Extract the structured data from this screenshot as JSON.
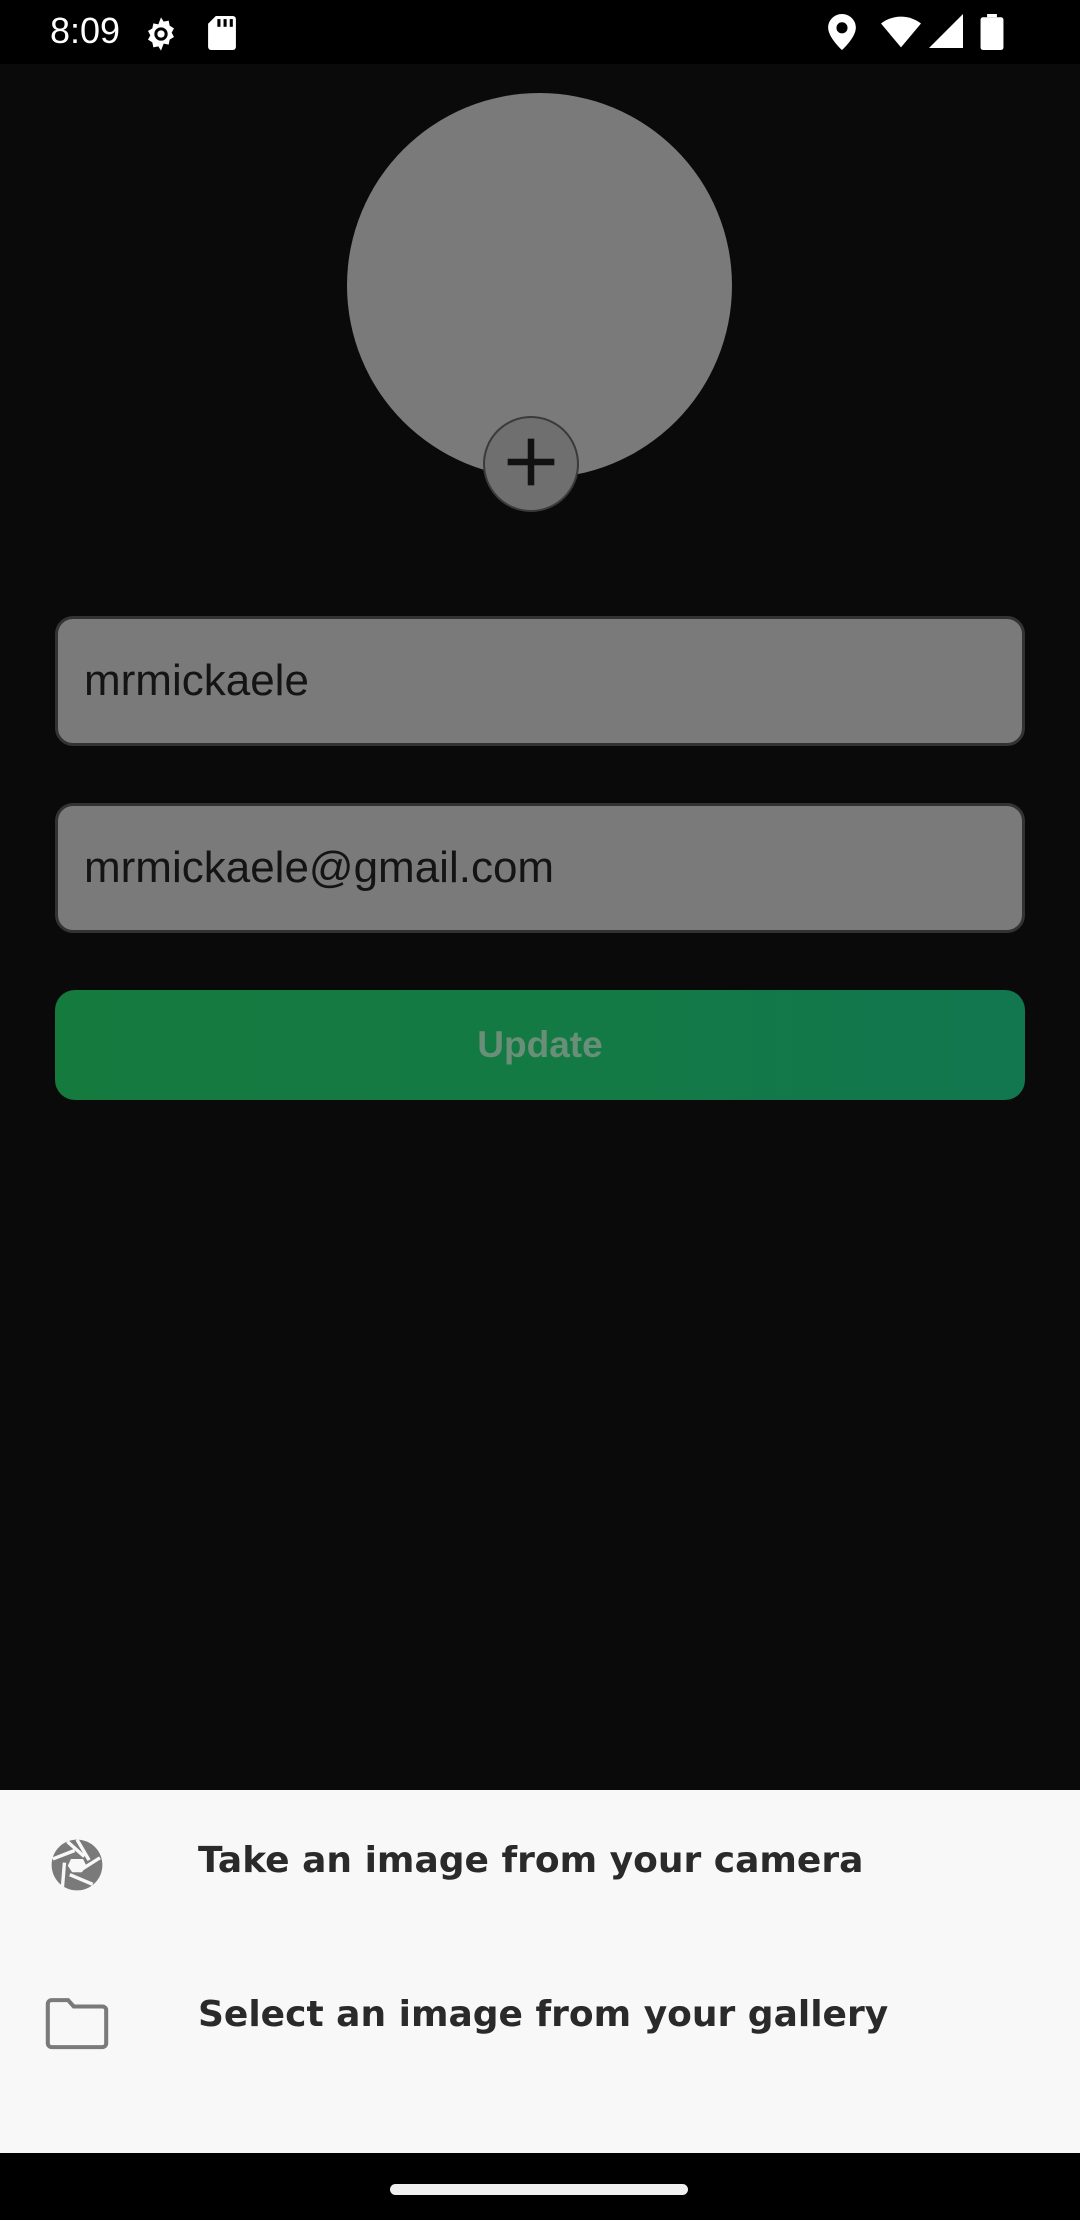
{
  "status_bar": {
    "time": "8:09",
    "icons": [
      "settings-gear-icon",
      "sd-card-icon",
      "location-icon",
      "wifi-icon",
      "signal-icon",
      "battery-icon"
    ]
  },
  "profile": {
    "username_value": "mrmickaele",
    "email_value": "mrmickaele@gmail.com",
    "update_label": "Update"
  },
  "sheet": {
    "options": [
      {
        "icon": "camera-aperture-icon",
        "label": "Take an image from your camera"
      },
      {
        "icon": "folder-icon",
        "label": "Select an image from your gallery"
      }
    ]
  },
  "colors": {
    "background": "#0a0a0a",
    "avatar": "#7a7a7a",
    "update_button": "#137a45",
    "sheet_background": "#f8f8f8"
  }
}
